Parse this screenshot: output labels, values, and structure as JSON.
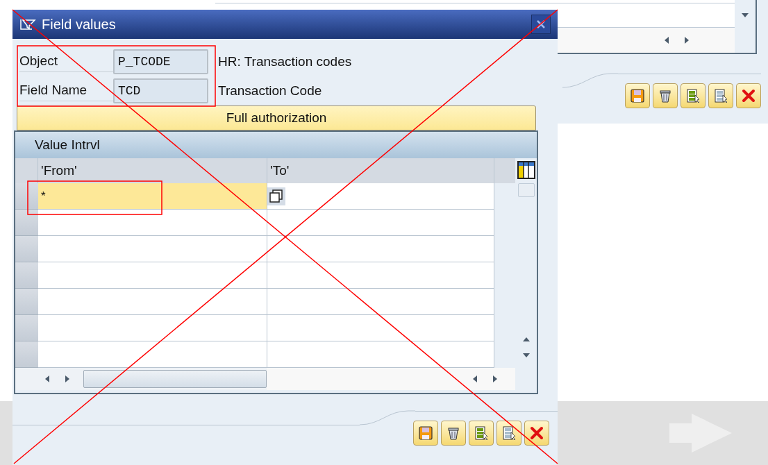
{
  "background_window": {
    "toolbar_buttons": [
      {
        "kind": "save"
      },
      {
        "kind": "delete"
      },
      {
        "kind": "select-all"
      },
      {
        "kind": "deselect"
      },
      {
        "kind": "cancel"
      }
    ]
  },
  "dialog": {
    "title": "Field values",
    "fields": [
      {
        "label": "Object",
        "value": "P_TCODE",
        "description": "HR: Transaction codes"
      },
      {
        "label": "Field Name",
        "value": "TCD",
        "description": "Transaction Code"
      }
    ],
    "full_authorization_button": "Full authorization",
    "table": {
      "title": "Value Intrvl",
      "columns": [
        "'From'",
        "'To'"
      ],
      "rows": [
        {
          "from": "*",
          "highlighted": true
        },
        {
          "highlighted": false
        },
        {
          "highlighted": false
        },
        {
          "highlighted": false
        },
        {
          "highlighted": false
        },
        {
          "highlighted": false
        },
        {
          "highlighted": false
        }
      ]
    },
    "footer_buttons": [
      {
        "kind": "save"
      },
      {
        "kind": "delete"
      },
      {
        "kind": "select-all"
      },
      {
        "kind": "deselect"
      },
      {
        "kind": "cancel"
      }
    ]
  },
  "annotations": {
    "cross_out": true,
    "frames": true
  }
}
